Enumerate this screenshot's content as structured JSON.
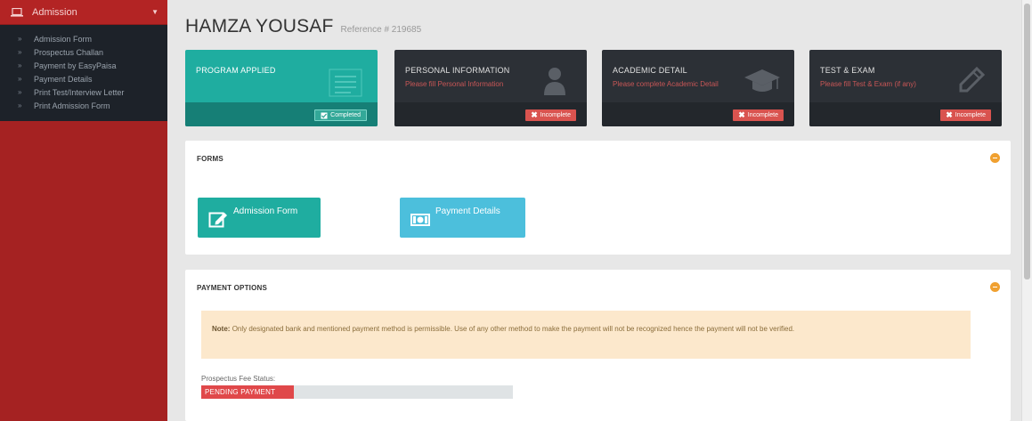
{
  "sidebar": {
    "header_label": "Admission",
    "items": [
      {
        "label": "Admission Form"
      },
      {
        "label": "Prospectus Challan"
      },
      {
        "label": "Payment by EasyPaisa"
      },
      {
        "label": "Payment Details"
      },
      {
        "label": "Print Test/Interview Letter"
      },
      {
        "label": "Print Admission Form"
      }
    ]
  },
  "header": {
    "name": "HAMZA YOUSAF",
    "reference": "Reference # 219685"
  },
  "status_boxes": [
    {
      "title": "PROGRAM APPLIED",
      "subtitle": "",
      "badge": "Completed",
      "state": "complete"
    },
    {
      "title": "PERSONAL INFORMATION",
      "subtitle": "Please fill Personal Information",
      "badge": "Incomplete",
      "state": "incomplete"
    },
    {
      "title": "ACADEMIC DETAIL",
      "subtitle": "Please complete Academic Detail",
      "badge": "Incomplete",
      "state": "incomplete"
    },
    {
      "title": "TEST & EXAM",
      "subtitle": "Please fill Test & Exam (if any)",
      "badge": "Incomplete",
      "state": "incomplete"
    }
  ],
  "forms_panel": {
    "heading": "FORMS",
    "admission_form_label": "Admission Form",
    "payment_details_label": "Payment Details"
  },
  "payment_panel": {
    "heading": "PAYMENT OPTIONS",
    "note_prefix": "Note:",
    "note_text": "Only designated bank and mentioned payment method is permissible. Use of any other method to make the payment will not be recognized hence the payment will not be verified.",
    "fee_status_label": "Prospectus Fee Status:",
    "fee_status_value": "PENDING PAYMENT"
  },
  "colors": {
    "sidebar_red": "#a52222",
    "sidebar_dark": "#1d2229",
    "teal": "#1fada0",
    "dark_box": "#2c3036",
    "incomplete_red": "#d9534f",
    "light_blue": "#4cbfdc",
    "orange": "#f0a030"
  }
}
